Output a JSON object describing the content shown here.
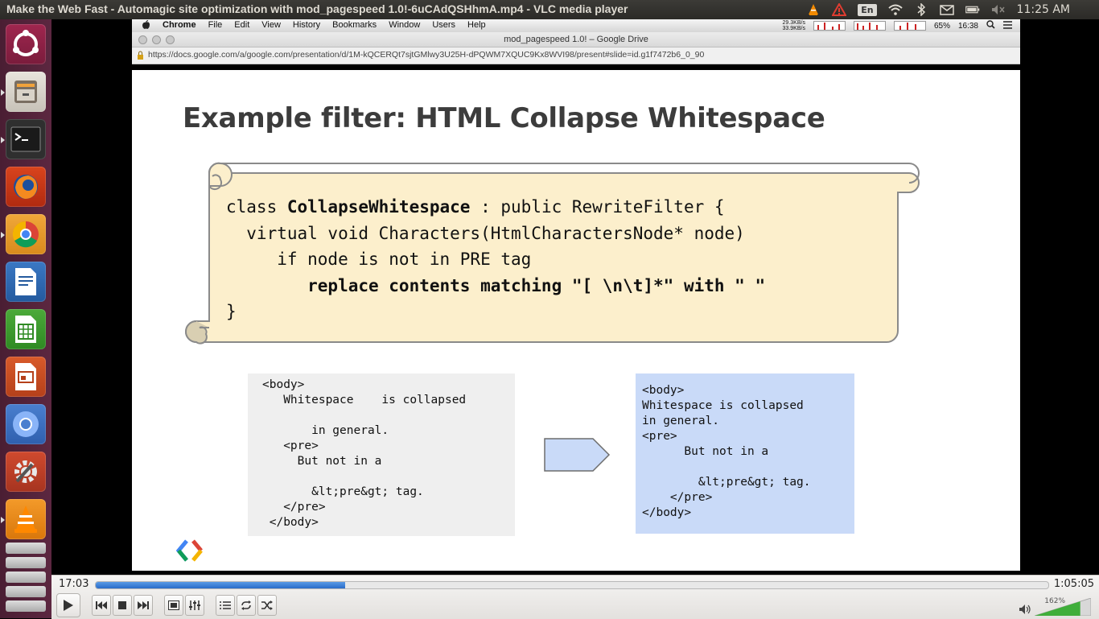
{
  "window": {
    "title": "Make the Web Fast - Automagic site optimization with mod_pagespeed 1.0!-6uCAdQSHhmA.mp4 - VLC media player",
    "kbd_layout": "En",
    "clock": "11:25 AM"
  },
  "launcher": {
    "items": [
      {
        "name": "ubuntu-dash"
      },
      {
        "name": "files"
      },
      {
        "name": "terminal"
      },
      {
        "name": "firefox"
      },
      {
        "name": "chrome"
      },
      {
        "name": "libreoffice-writer"
      },
      {
        "name": "libreoffice-calc"
      },
      {
        "name": "libreoffice-impress"
      },
      {
        "name": "chromium"
      },
      {
        "name": "system-settings"
      },
      {
        "name": "vlc"
      }
    ]
  },
  "mac_menu": {
    "items": [
      "Chrome",
      "File",
      "Edit",
      "View",
      "History",
      "Bookmarks",
      "Window",
      "Users",
      "Help"
    ],
    "battery": "65%",
    "time": "16:38",
    "net_up": "29.3KB/s",
    "net_down": "33.9KB/s"
  },
  "browser": {
    "title": "mod_pagespeed 1.0! – Google Drive",
    "url": "https://docs.google.com/a/google.com/presentation/d/1M-kQCERQt7sjtGMlwy3U25H-dPQWM7XQUC9Kx8WVI98/present#slide=id.g1f7472b6_0_90"
  },
  "slide": {
    "title": "Example filter: HTML Collapse Whitespace",
    "code": {
      "l1_a": "class ",
      "l1_b": "CollapseWhitespace",
      "l1_c": " : public RewriteFilter {",
      "l2": "  virtual void Characters(HtmlCharactersNode* node)",
      "l3": "     if node is not in PRE tag",
      "l4": "        replace contents matching \"[ \\n\\t]*\" with \" \"",
      "l5": "}"
    },
    "before_text": "<body>\n   Whitespace    is collapsed\n\n       in general.\n   <pre>\n     But not in a\n\n       &lt;pre&gt; tag.\n   </pre>\n </body>",
    "after_text": "<body>\nWhitespace is collapsed\nin general.\n<pre>\n      But not in a\n\n        &lt;pre&gt; tag.\n    </pre>\n</body>"
  },
  "player": {
    "elapsed": "17:03",
    "total": "1:05:05",
    "progress_fraction": 0.262,
    "volume_pct": "162%",
    "volume_fraction": 0.81
  },
  "colors": {
    "scroll_fill": "#fcefcc",
    "scroll_stroke": "#8a8a8a",
    "after_bg": "#c9daf8",
    "before_bg": "#efefef",
    "seek": "#2a6cc8"
  }
}
